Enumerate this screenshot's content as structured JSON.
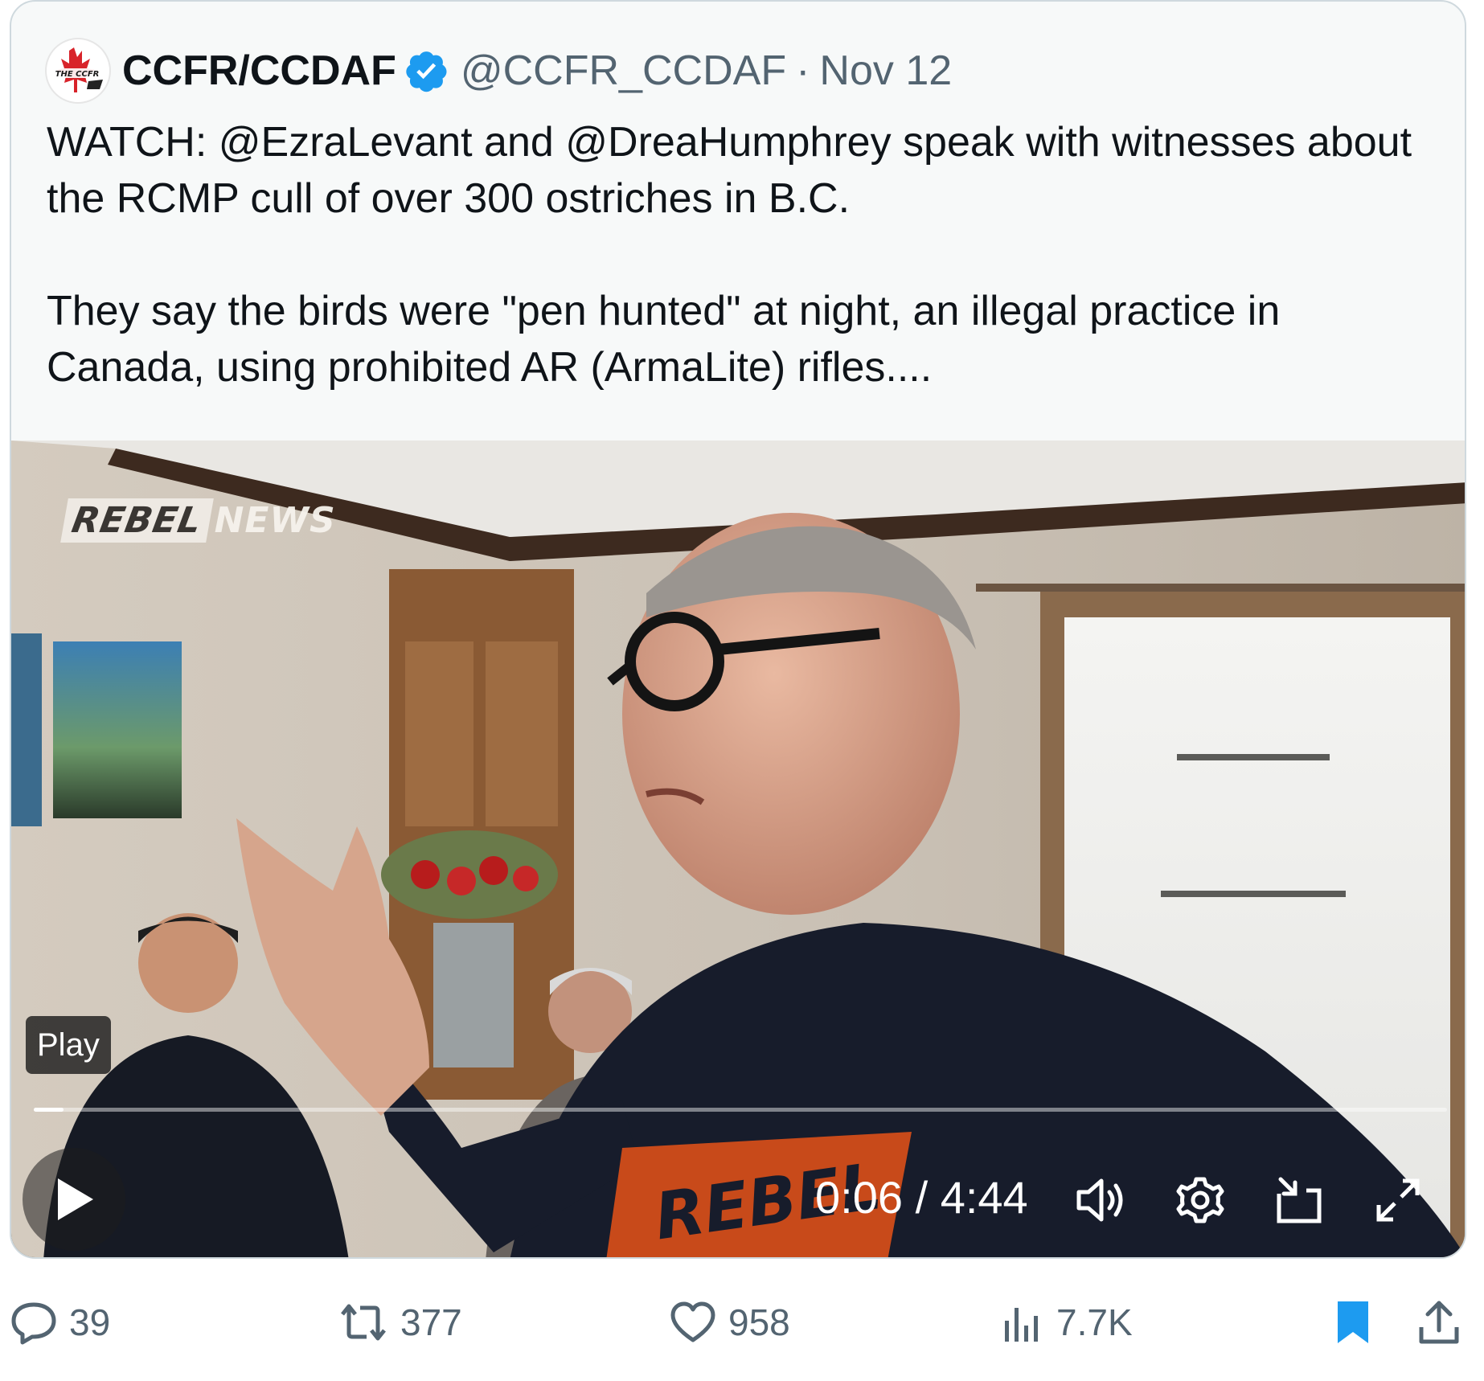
{
  "quoted_tweet": {
    "display_name": "CCFR/CCDAF",
    "handle": "@CCFR_CCDAF",
    "separator": "·",
    "date": "Nov 12",
    "avatar_text": "THE CCFR",
    "text": "WATCH: @EzraLevant and @DreaHumphrey speak with witnesses about the RCMP cull of over 300 ostriches in B.C.\n\nThey say the birds were \"pen hunted\" at night, an illegal practice in Canada, using prohibited AR (ArmaLite) rifles....",
    "video": {
      "watermark_left": "REBEL",
      "watermark_right": "NEWS",
      "tooltip": "Play",
      "current_time": "0:06",
      "time_separator": "/",
      "duration": "4:44",
      "progress_fraction": 0.021,
      "icons": [
        "play-icon",
        "volume-icon",
        "settings-icon",
        "picture-in-picture-icon",
        "fullscreen-icon"
      ]
    }
  },
  "actions": {
    "replies": "39",
    "reposts": "377",
    "likes": "958",
    "views": "7.7K"
  },
  "colors": {
    "verified_blue": "#1d9bf0",
    "bookmark_blue": "#1d9bf0",
    "secondary_text": "#536471",
    "card_border": "#cfd9de"
  }
}
